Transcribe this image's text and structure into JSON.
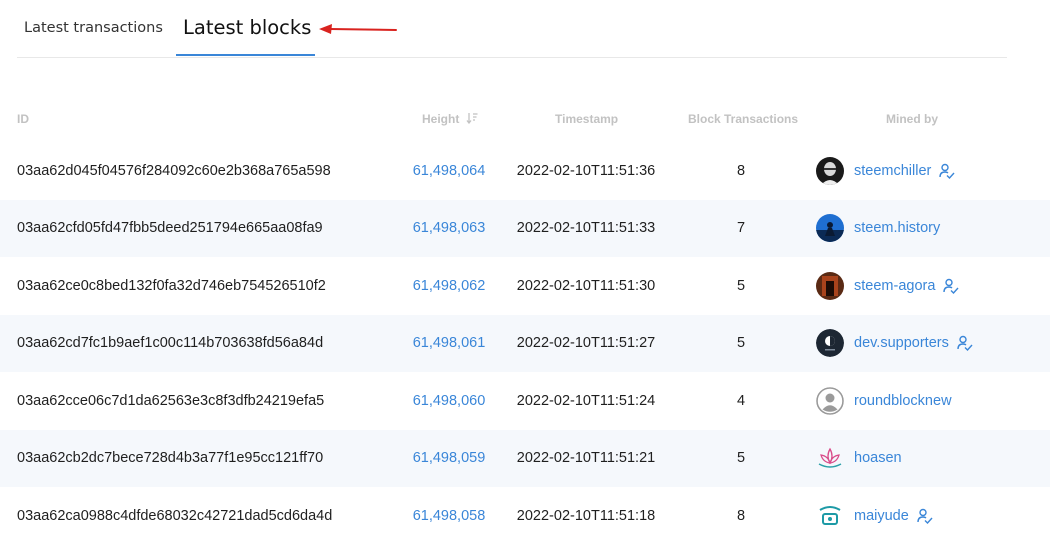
{
  "tabs": {
    "transactions": "Latest transactions",
    "blocks": "Latest blocks"
  },
  "columns": {
    "id": "ID",
    "height": "Height",
    "timestamp": "Timestamp",
    "block_transactions": "Block Transactions",
    "mined_by": "Mined by"
  },
  "colors": {
    "link": "#3a86d8",
    "row_alt": "#f5f8fc",
    "arrow": "#d9231f"
  },
  "rows": [
    {
      "id": "03aa62d045f04576f284092c60e2b368a765a598",
      "height": "61,498,064",
      "timestamp": "2022-02-10T11:51:36",
      "tx": "8",
      "miner": "steemchiller",
      "avatar": "dark-photo-avatar",
      "verified": true
    },
    {
      "id": "03aa62cfd05fd47fbb5deed251794e665aa08fa9",
      "height": "61,498,063",
      "timestamp": "2022-02-10T11:51:33",
      "tx": "7",
      "miner": "steem.history",
      "avatar": "blue-photo-avatar",
      "verified": false
    },
    {
      "id": "03aa62ce0c8bed132f0fa32d746eb754526510f2",
      "height": "61,498,062",
      "timestamp": "2022-02-10T11:51:30",
      "tx": "5",
      "miner": "steem-agora",
      "avatar": "red-photo-avatar",
      "verified": true
    },
    {
      "id": "03aa62cd7fc1b9aef1c00c114b703638fd56a84d",
      "height": "61,498,061",
      "timestamp": "2022-02-10T11:51:27",
      "tx": "5",
      "miner": "dev.supporters",
      "avatar": "dark-logo-avatar",
      "verified": true
    },
    {
      "id": "03aa62cce06c7d1da62563e3c8f3dfb24219efa5",
      "height": "61,498,060",
      "timestamp": "2022-02-10T11:51:24",
      "tx": "4",
      "miner": "roundblocknew",
      "avatar": "default-user-avatar",
      "verified": false
    },
    {
      "id": "03aa62cb2dc7bece728d4b3a77f1e95cc121ff70",
      "height": "61,498,059",
      "timestamp": "2022-02-10T11:51:21",
      "tx": "5",
      "miner": "hoasen",
      "avatar": "lotus-avatar",
      "verified": false
    },
    {
      "id": "03aa62ca0988c4dfde68032c42721dad5cd6da4d",
      "height": "61,498,058",
      "timestamp": "2022-02-10T11:51:18",
      "tx": "8",
      "miner": "maiyude",
      "avatar": "teal-logo-avatar",
      "verified": true
    }
  ]
}
